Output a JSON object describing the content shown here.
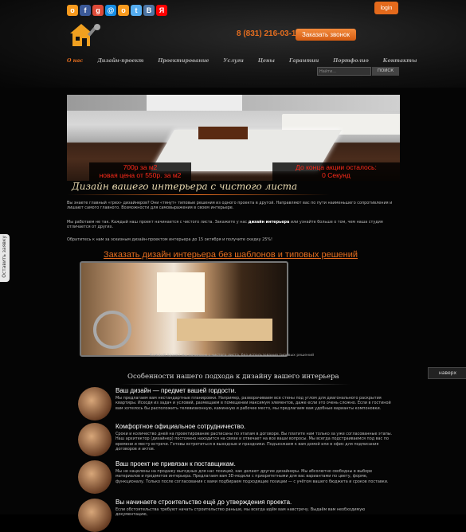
{
  "header": {
    "social": [
      {
        "name": "odnoklassniki-icon",
        "glyph": "о",
        "color": "#f79a1e"
      },
      {
        "name": "facebook-icon",
        "glyph": "f",
        "color": "#3b5998"
      },
      {
        "name": "google-icon",
        "glyph": "g",
        "color": "#dd4b39"
      },
      {
        "name": "mailru-icon",
        "glyph": "@",
        "color": "#168de2"
      },
      {
        "name": "ok-icon",
        "glyph": "o",
        "color": "#f79a1e"
      },
      {
        "name": "twitter-icon",
        "glyph": "t",
        "color": "#55acee"
      },
      {
        "name": "vk-icon",
        "glyph": "B",
        "color": "#4c75a3"
      },
      {
        "name": "yandex-icon",
        "glyph": "Я",
        "color": "#ff0000"
      }
    ],
    "login": "login",
    "phone": "8 (831) 216-03-12",
    "call_button": "Заказать звонок"
  },
  "nav": {
    "items": [
      "О нас",
      "Дизайн-проект",
      "Проектирование",
      "Услуги",
      "Цены",
      "Гарантии",
      "Портфолио",
      "Контакты"
    ],
    "search_placeholder": "Найти...",
    "search_button": "ПОИСК"
  },
  "hero": {
    "price_line1": "700р за м2",
    "price_line2": "новая цена от 550р. за м2",
    "promo_line1": "До конца акции осталось:",
    "promo_line2": "0 Секунд"
  },
  "main": {
    "title": "Дизайн вашего интерьера с чистого листа",
    "para1": "Вы знаете главный «грех» дизайнеров? Они «тянут» типовые решения из одного проекта в другой. Направляют вас по пути наименьшего сопротивления и лишают самого главного. Возможности для самовыражения в своем интерьере.",
    "para2_a": "Мы работаем не так. Каждый наш проект начинается с чистого листа. Закажите у нас ",
    "para2_b": "дизайн интерьера",
    "para2_c": " или узнайте больше о том, чем наша студия отличается от других.",
    "para3": "Обратитесь к нам за эскизным дизайн-проектом интерьера до 15 октября и получите скидку 25%!",
    "subtitle": "Заказать дизайн интерьера без шаблонов и типовых решений",
    "caption": "Каждый проект мы начинаем с чистого листа, без использования типовых решений",
    "features_title": "Особенности нашего подхода к дизайну вашего интерьера"
  },
  "features": [
    {
      "title": "Ваш дизайн — предмет вашей гордости.",
      "desc": "Мы предлагаем вам нестандартные планировки. Например, разворачиваем все стены под углом для диагонального раскрытия квартиры. Исходя из задач и условий, размещаем в помещении максимум элементов, даже если это очень сложно. Если в гостиной вам хотелось бы расположить телевизионную, каминную и рабочее место, мы предлагаем вам удобные варианты компоновки."
    },
    {
      "title": "Комфортное официальное сотрудничество.",
      "desc": "Сроки и количество дней на проектирование расписаны по этапам в договоре. Вы платите нам только за уже согласованные этапы. Наш архитектор (дизайнер) постоянно находится на связи и отвечает на все ваши вопросы. Мы всегда подстраиваемся под вас по времени и месту встречи. Готовы встретиться в выходные и праздники. Подъезжаем к вам домой или в офис для подписания договоров и актов."
    },
    {
      "title": "Ваш проект не привязан к поставщикам.",
      "desc": "Мы не нацелены на продажу выгодных для нас позиций, как делают другие дизайнеры. Мы абсолютно свободны в выборе материалов и предметов интерьера. Предлагаем вам 3D-модели с приоритетными для вас вариантами по цвету, форме, функционалу. Только после согласования с вами подбираем подходящие позиции — с учётом вашего бюджета и сроков поставки."
    },
    {
      "title": "Вы начинаете строительство ещё до утверждения проекта.",
      "desc": "Если обстоятельства требуют начать строительство раньше, мы всегда идём вам навстречу. Выдаём вам необходимую документацию,"
    }
  ],
  "widgets": {
    "naverh": "наверх",
    "side_tab": "Оставить заявку"
  }
}
